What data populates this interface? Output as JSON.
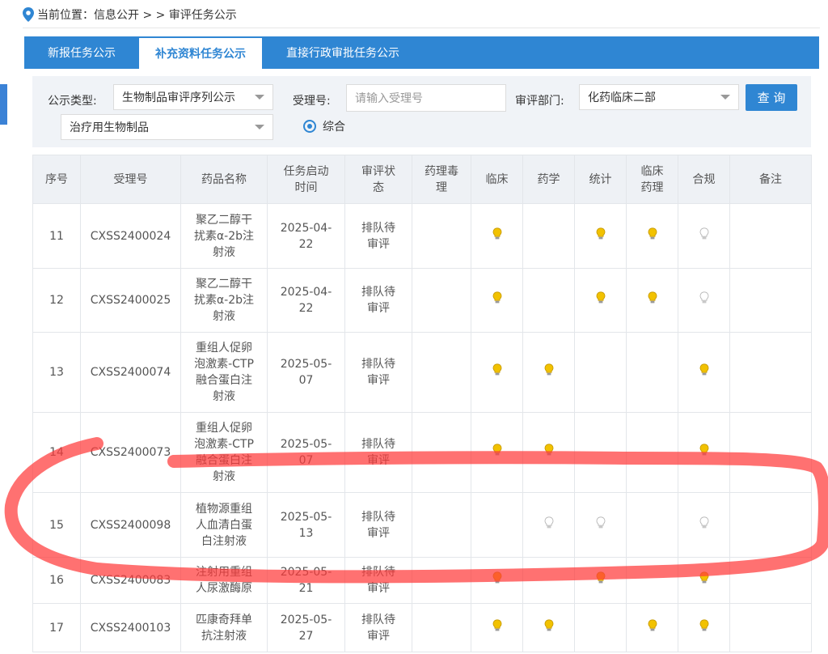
{
  "breadcrumb": {
    "label": "当前位置：",
    "path": "信息公开 > > 审评任务公示"
  },
  "tabs": [
    {
      "label": "新报任务公示"
    },
    {
      "label": "补充资料任务公示"
    },
    {
      "label": "直接行政审批任务公示"
    }
  ],
  "filters": {
    "type_label": "公示类型:",
    "type_value": "生物制品审评序列公示",
    "subtype_value": "治疗用生物制品",
    "accept_label": "受理号:",
    "accept_placeholder": "请输入受理号",
    "dept_label": "审评部门:",
    "dept_value": "化药临床二部",
    "query_button": "查 询",
    "radio_label": "综合"
  },
  "colors": {
    "accent": "#2f86d3",
    "bulb_on": "#f2c200",
    "bulb_off": "#d9d9d9",
    "highlight": "#ff3a3a"
  },
  "table": {
    "headers": [
      "序号",
      "受理号",
      "药品名称",
      "任务启动\n时间",
      "审评状\n态",
      "药理毒\n理",
      "临床",
      "药学",
      "统计",
      "临床\n药理",
      "合规",
      "备注"
    ],
    "rows": [
      {
        "no": "11",
        "code": "CXSS2400024",
        "name": "聚乙二醇干\n扰素α-2b注\n射液",
        "date": "2025-04-\n22",
        "status": "排队待\n审评",
        "bulbs": [
          "",
          "on",
          "",
          "on",
          "on",
          "off"
        ]
      },
      {
        "no": "12",
        "code": "CXSS2400025",
        "name": "聚乙二醇干\n扰素α-2b注\n射液",
        "date": "2025-04-\n22",
        "status": "排队待\n审评",
        "bulbs": [
          "",
          "on",
          "",
          "on",
          "on",
          "off"
        ]
      },
      {
        "no": "13",
        "code": "CXSS2400074",
        "name": "重组人促卵\n泡激素-CTP\n融合蛋白注\n射液",
        "date": "2025-05-\n07",
        "status": "排队待\n审评",
        "bulbs": [
          "",
          "on",
          "on",
          "",
          "",
          "on"
        ]
      },
      {
        "no": "14",
        "code": "CXSS2400073",
        "name": "重组人促卵\n泡激素-CTP\n融合蛋白注\n射液",
        "date": "2025-05-\n07",
        "status": "排队待\n审评",
        "bulbs": [
          "",
          "on",
          "on",
          "",
          "",
          "on"
        ]
      },
      {
        "no": "15",
        "code": "CXSS2400098",
        "name": "植物源重组\n人血清白蛋\n白注射液",
        "date": "2025-05-\n13",
        "status": "排队待\n审评",
        "bulbs": [
          "",
          "",
          "off",
          "off",
          "",
          "off"
        ]
      },
      {
        "no": "16",
        "code": "CXSS2400083",
        "name": "注射用重组\n人尿激酶原",
        "date": "2025-05-\n21",
        "status": "排队待\n审评",
        "bulbs": [
          "",
          "on",
          "",
          "on",
          "",
          "on"
        ]
      },
      {
        "no": "17",
        "code": "CXSS2400103",
        "name": "匹康奇拜单\n抗注射液",
        "date": "2025-05-\n27",
        "status": "排队待\n审评",
        "bulbs": [
          "",
          "on",
          "on",
          "",
          "on",
          "on"
        ]
      }
    ]
  }
}
